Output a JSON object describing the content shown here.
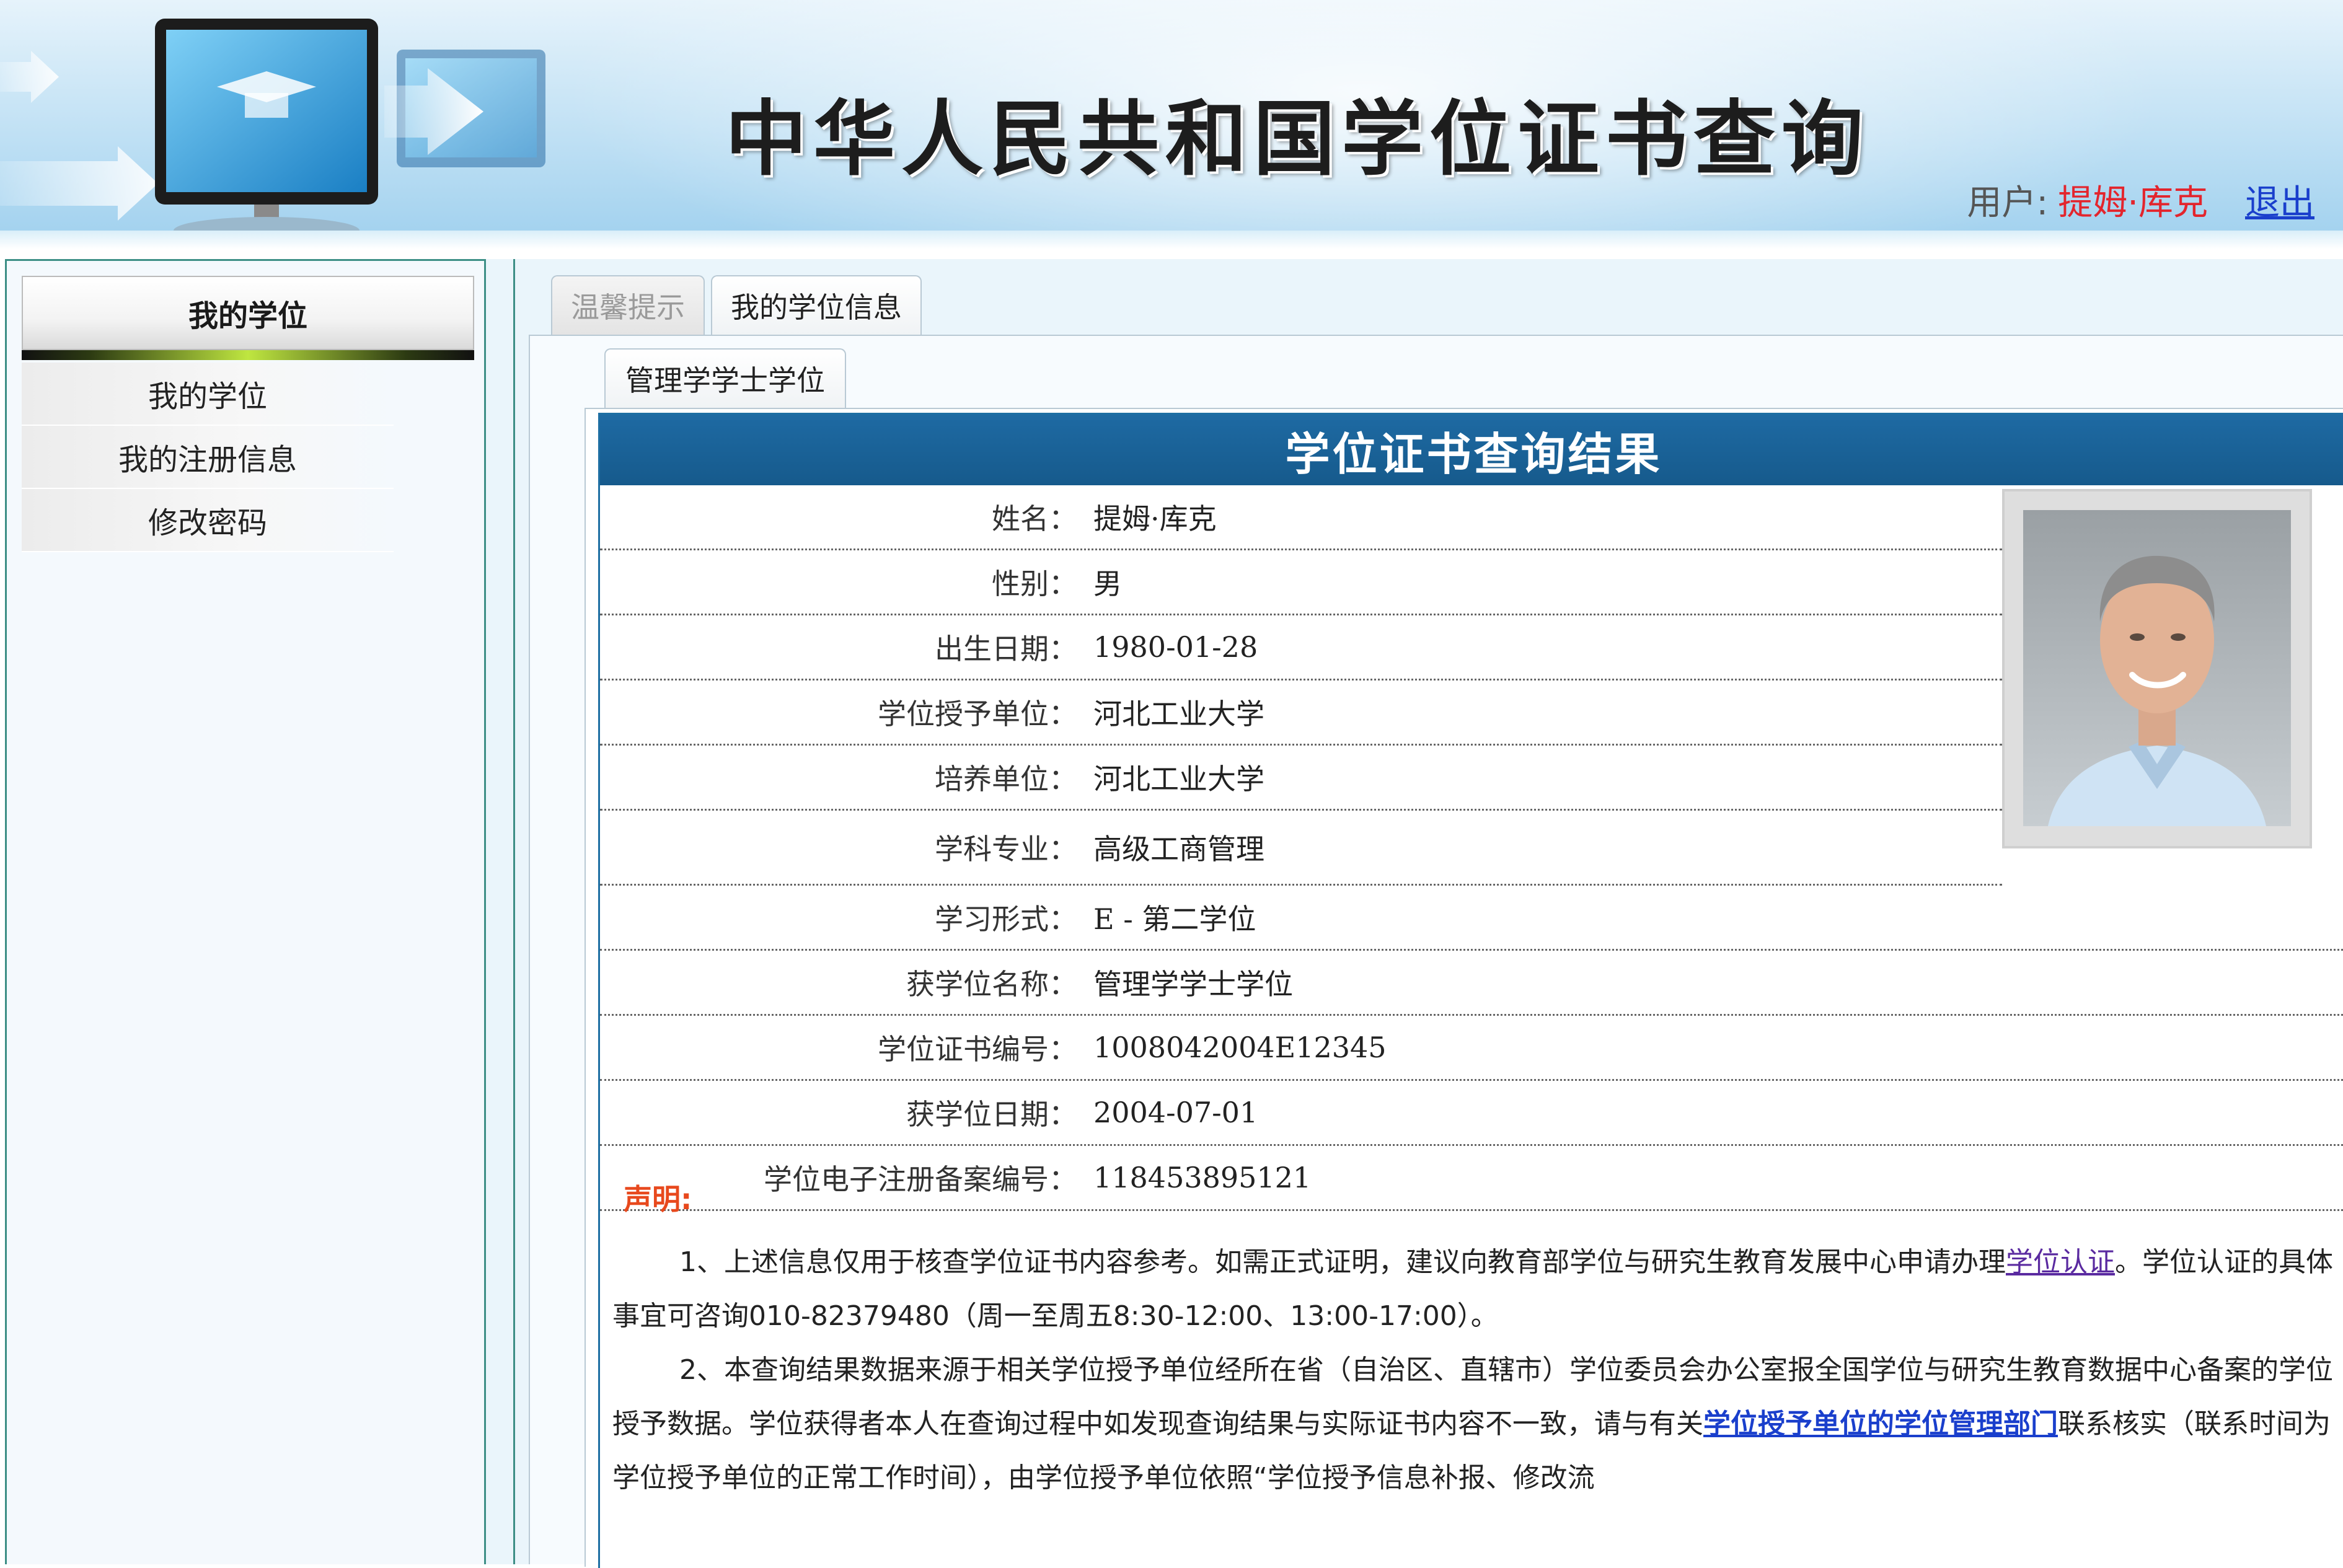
{
  "header": {
    "site_title": "中华人民共和国学位证书查询",
    "user_label": "用户:",
    "user_name": "提姆·库克",
    "logout_label": "退出"
  },
  "sidebar": {
    "title": "我的学位",
    "items": [
      {
        "label": "我的学位"
      },
      {
        "label": "我的注册信息"
      },
      {
        "label": "修改密码"
      }
    ]
  },
  "tabs": [
    {
      "label": "温馨提示",
      "active": false
    },
    {
      "label": "我的学位信息",
      "active": true
    }
  ],
  "subtab": {
    "label": "管理学学士学位"
  },
  "result": {
    "title": "学位证书查询结果",
    "rows": [
      {
        "label": "姓名：",
        "value": "提姆·库克"
      },
      {
        "label": "性别：",
        "value": "男"
      },
      {
        "label": "出生日期：",
        "value": "1980-01-28"
      },
      {
        "label": "学位授予单位：",
        "value": "河北工业大学"
      },
      {
        "label": "培养单位：",
        "value": "河北工业大学"
      },
      {
        "label": "学科专业：",
        "value": "高级工商管理"
      },
      {
        "label": "学习形式：",
        "value": "E - 第二学位"
      },
      {
        "label": "获学位名称：",
        "value": "管理学学士学位"
      },
      {
        "label": "学位证书编号：",
        "value": "1008042004E12345"
      },
      {
        "label": "获学位日期：",
        "value": "2004-07-01"
      },
      {
        "label": "学位电子注册备案编号：",
        "value": "118453895121"
      }
    ]
  },
  "declaration": {
    "title": "声明:",
    "p1_text1": "1、上述信息仅用于核查学位证书内容参考。如需正式证明，建议向教育部学位与研究生教育发展中心申请办理",
    "p1_link": "学位认证",
    "p1_text2": "。学位认证的具体事宜可咨询010-82379480（周一至周五8:30-12:00、13:00-17:00）。",
    "p2_text1": "2、本查询结果数据来源于相关学位授予单位经所在省（自治区、直辖市）学位委员会办公室报全国学位与研究生教育数据中心备案的学位授予数据。学位获得者本人在查询过程中如发现查询结果与实际证书内容不一致，请与有关",
    "p2_link": "学位授予单位的学位管理部门",
    "p2_text2": "联系核实（联系时间为学位授予单位的正常工作时间），由学位授予单位依照“学位授予信息补报、修改流"
  },
  "colors": {
    "header_bg": "#bfe0f4",
    "user_name": "#e3252d",
    "link_blue": "#1a3fcc",
    "title_bar": "#1e6aa3",
    "declaration_title": "#e8491d",
    "frame_border": "#3d8f86"
  }
}
